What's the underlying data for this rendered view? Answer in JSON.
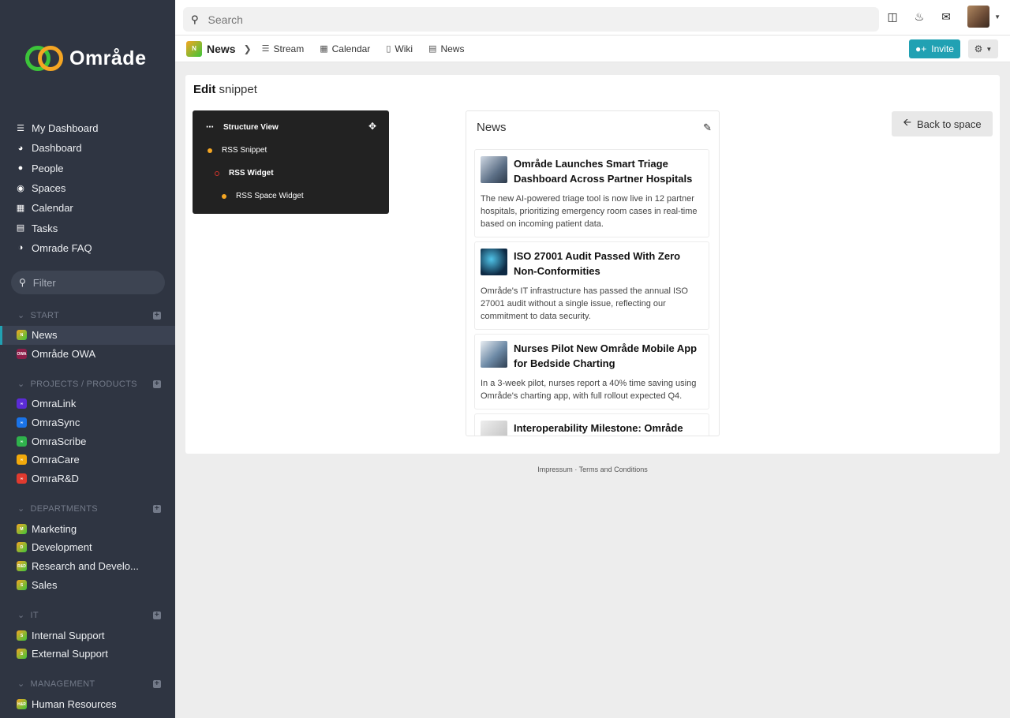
{
  "brand": {
    "name": "Område"
  },
  "sidebar": {
    "main": [
      {
        "label": "My Dashboard",
        "icon": "database-icon"
      },
      {
        "label": "Dashboard",
        "icon": "dashboard-icon"
      },
      {
        "label": "People",
        "icon": "people-icon"
      },
      {
        "label": "Spaces",
        "icon": "spaces-icon"
      },
      {
        "label": "Calendar",
        "icon": "calendar-icon"
      },
      {
        "label": "Tasks",
        "icon": "tasks-icon"
      },
      {
        "label": "Omrade FAQ",
        "icon": "faq-icon"
      }
    ],
    "filter_placeholder": "Filter",
    "sections": {
      "start": {
        "title": "START",
        "items": [
          {
            "label": "News",
            "badge": "N",
            "color": "#7cb518"
          },
          {
            "label": "Område OWA",
            "badge": "OWA",
            "color": "#8e1f4a"
          }
        ]
      },
      "projects": {
        "title": "PROJECTS / PRODUCTS",
        "items": [
          {
            "label": "OmraLink",
            "color": "#5b2bd6"
          },
          {
            "label": "OmraSync",
            "color": "#1a73e8"
          },
          {
            "label": "OmraScribe",
            "color": "#2fb24c"
          },
          {
            "label": "OmraCare",
            "color": "#f2a90b"
          },
          {
            "label": "OmraR&D",
            "color": "#e03a2f"
          }
        ]
      },
      "departments": {
        "title": "DEPARTMENTS",
        "items": [
          {
            "label": "Marketing",
            "badge": "M"
          },
          {
            "label": "Development",
            "badge": "D"
          },
          {
            "label": "Research and Develo...",
            "badge": "R&D"
          },
          {
            "label": "Sales",
            "badge": "S"
          }
        ]
      },
      "it": {
        "title": "IT",
        "items": [
          {
            "label": "Internal Support",
            "badge": "S"
          },
          {
            "label": "External Support",
            "badge": "S"
          }
        ]
      },
      "management": {
        "title": "MANAGEMENT",
        "items": [
          {
            "label": "Human Resources",
            "badge": "H&R"
          }
        ]
      }
    }
  },
  "topbar": {
    "search_placeholder": "Search"
  },
  "subnav": {
    "space_badge": "N",
    "space_title": "News",
    "links": [
      "Stream",
      "Calendar",
      "Wiki",
      "News"
    ],
    "invite_label": "Invite"
  },
  "panel": {
    "title_bold": "Edit",
    "title_rest": "snippet",
    "back_label": "Back to space",
    "structure": {
      "title": "Structure View",
      "nodes": [
        "RSS Snippet",
        "RSS Widget",
        "RSS Space Widget"
      ]
    },
    "widget": {
      "title": "News",
      "cards": [
        {
          "title": "Område Launches Smart Triage Dashboard Across Partner Hospitals",
          "text": "The new AI-powered triage tool is now live in 12 partner hospitals, prioritizing emergency room cases in real-time based on incoming patient data."
        },
        {
          "title": "ISO 27001 Audit Passed With Zero Non-Conformities",
          "text": "Område's IT infrastructure has passed the annual ISO 27001 audit without a single issue, reflecting our commitment to data security."
        },
        {
          "title": "Nurses Pilot New Område Mobile App for Bedside Charting",
          "text": "In a 3-week pilot, nurses report a 40% time saving using Område's charting app, with full rollout expected Q4."
        },
        {
          "title": "Interoperability Milestone: Område",
          "text": ""
        }
      ]
    }
  },
  "footer": {
    "impressum": "Impressum",
    "separator": "·",
    "terms": "Terms and Conditions"
  }
}
